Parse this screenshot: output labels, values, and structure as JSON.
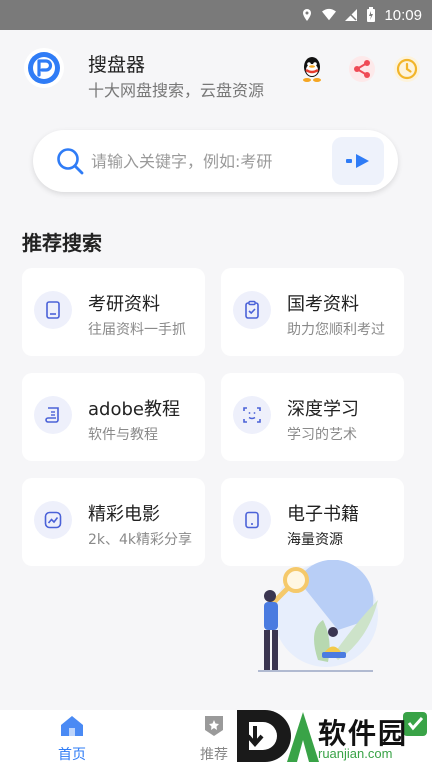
{
  "status_bar": {
    "time": "10:09"
  },
  "header": {
    "title": "搜盘器",
    "subtitle": "十大网盘搜索，云盘资源",
    "icons": [
      "qq-icon",
      "share-icon",
      "history-icon"
    ]
  },
  "search": {
    "placeholder": "请输入关键字，例如:考研"
  },
  "section": {
    "title": "推荐搜索"
  },
  "cards": [
    {
      "title": "考研资料",
      "subtitle": "往届资料一手抓",
      "icon": "document-icon"
    },
    {
      "title": "国考资料",
      "subtitle": "助力您顺利考过",
      "icon": "clipboard-check-icon"
    },
    {
      "title": "adobe教程",
      "subtitle": "软件与教程",
      "icon": "scroll-icon"
    },
    {
      "title": "深度学习",
      "subtitle": "学习的艺术",
      "icon": "face-scan-icon"
    },
    {
      "title": "精彩电影",
      "subtitle": "2k、4k精彩分享",
      "icon": "trend-icon"
    },
    {
      "title": "电子书籍",
      "subtitle": "海量资源",
      "icon": "tablet-icon"
    }
  ],
  "bottom_nav": [
    {
      "label": "首页",
      "icon": "home-icon",
      "active": true
    },
    {
      "label": "推荐",
      "icon": "badge-icon",
      "active": false
    }
  ],
  "watermark": {
    "text": "软件园",
    "url": "ruanjian.com"
  },
  "colors": {
    "accent": "#2f7cf6",
    "muted": "#8a8a8a"
  }
}
